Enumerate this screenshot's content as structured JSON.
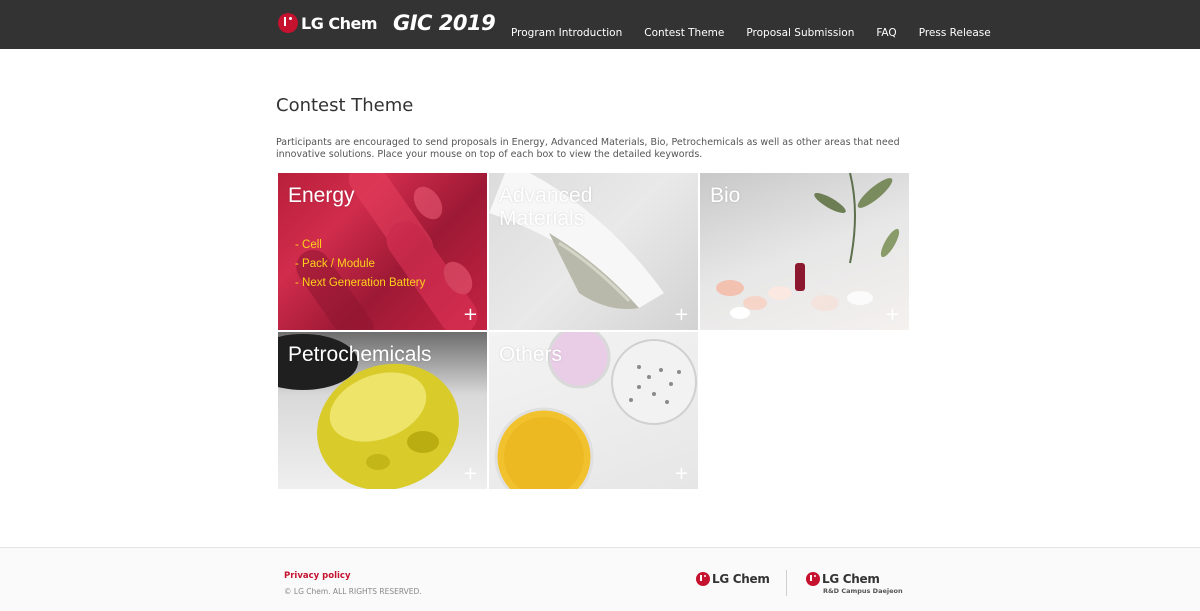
{
  "header": {
    "brand": "LG Chem",
    "event_logo": "GIC 2019",
    "nav": [
      {
        "label": "Program Introduction"
      },
      {
        "label": "Contest Theme"
      },
      {
        "label": "Proposal Submission"
      },
      {
        "label": "FAQ"
      },
      {
        "label": "Press Release"
      }
    ]
  },
  "main": {
    "title": "Contest Theme",
    "intro": "Participants are encouraged to send proposals in Energy, Advanced Materials, Bio, Petrochemicals as well as other areas that need innovative solutions. Place your mouse on top of each box to view the detailed keywords.",
    "themes": [
      {
        "name": "Energy",
        "keywords": [
          "- Cell",
          "- Pack / Module",
          "- Next Generation Battery"
        ],
        "plus": "+"
      },
      {
        "name": "Advanced\nMaterials",
        "plus": "+"
      },
      {
        "name": "Bio",
        "plus": "+"
      },
      {
        "name": "Petrochemicals",
        "plus": "+"
      },
      {
        "name": "Others",
        "plus": "+"
      }
    ],
    "keyword_color": "#ffd21a"
  },
  "footer": {
    "privacy": "Privacy policy",
    "copyright": "© LG Chem. ALL RIGHTS RESERVED.",
    "logo_left": "LG Chem",
    "logo_right": "LG Chem",
    "logo_right_sub": "R&D Campus Daejeon"
  },
  "colors": {
    "header_bg": "#333333",
    "brand_red": "#c4122f"
  }
}
